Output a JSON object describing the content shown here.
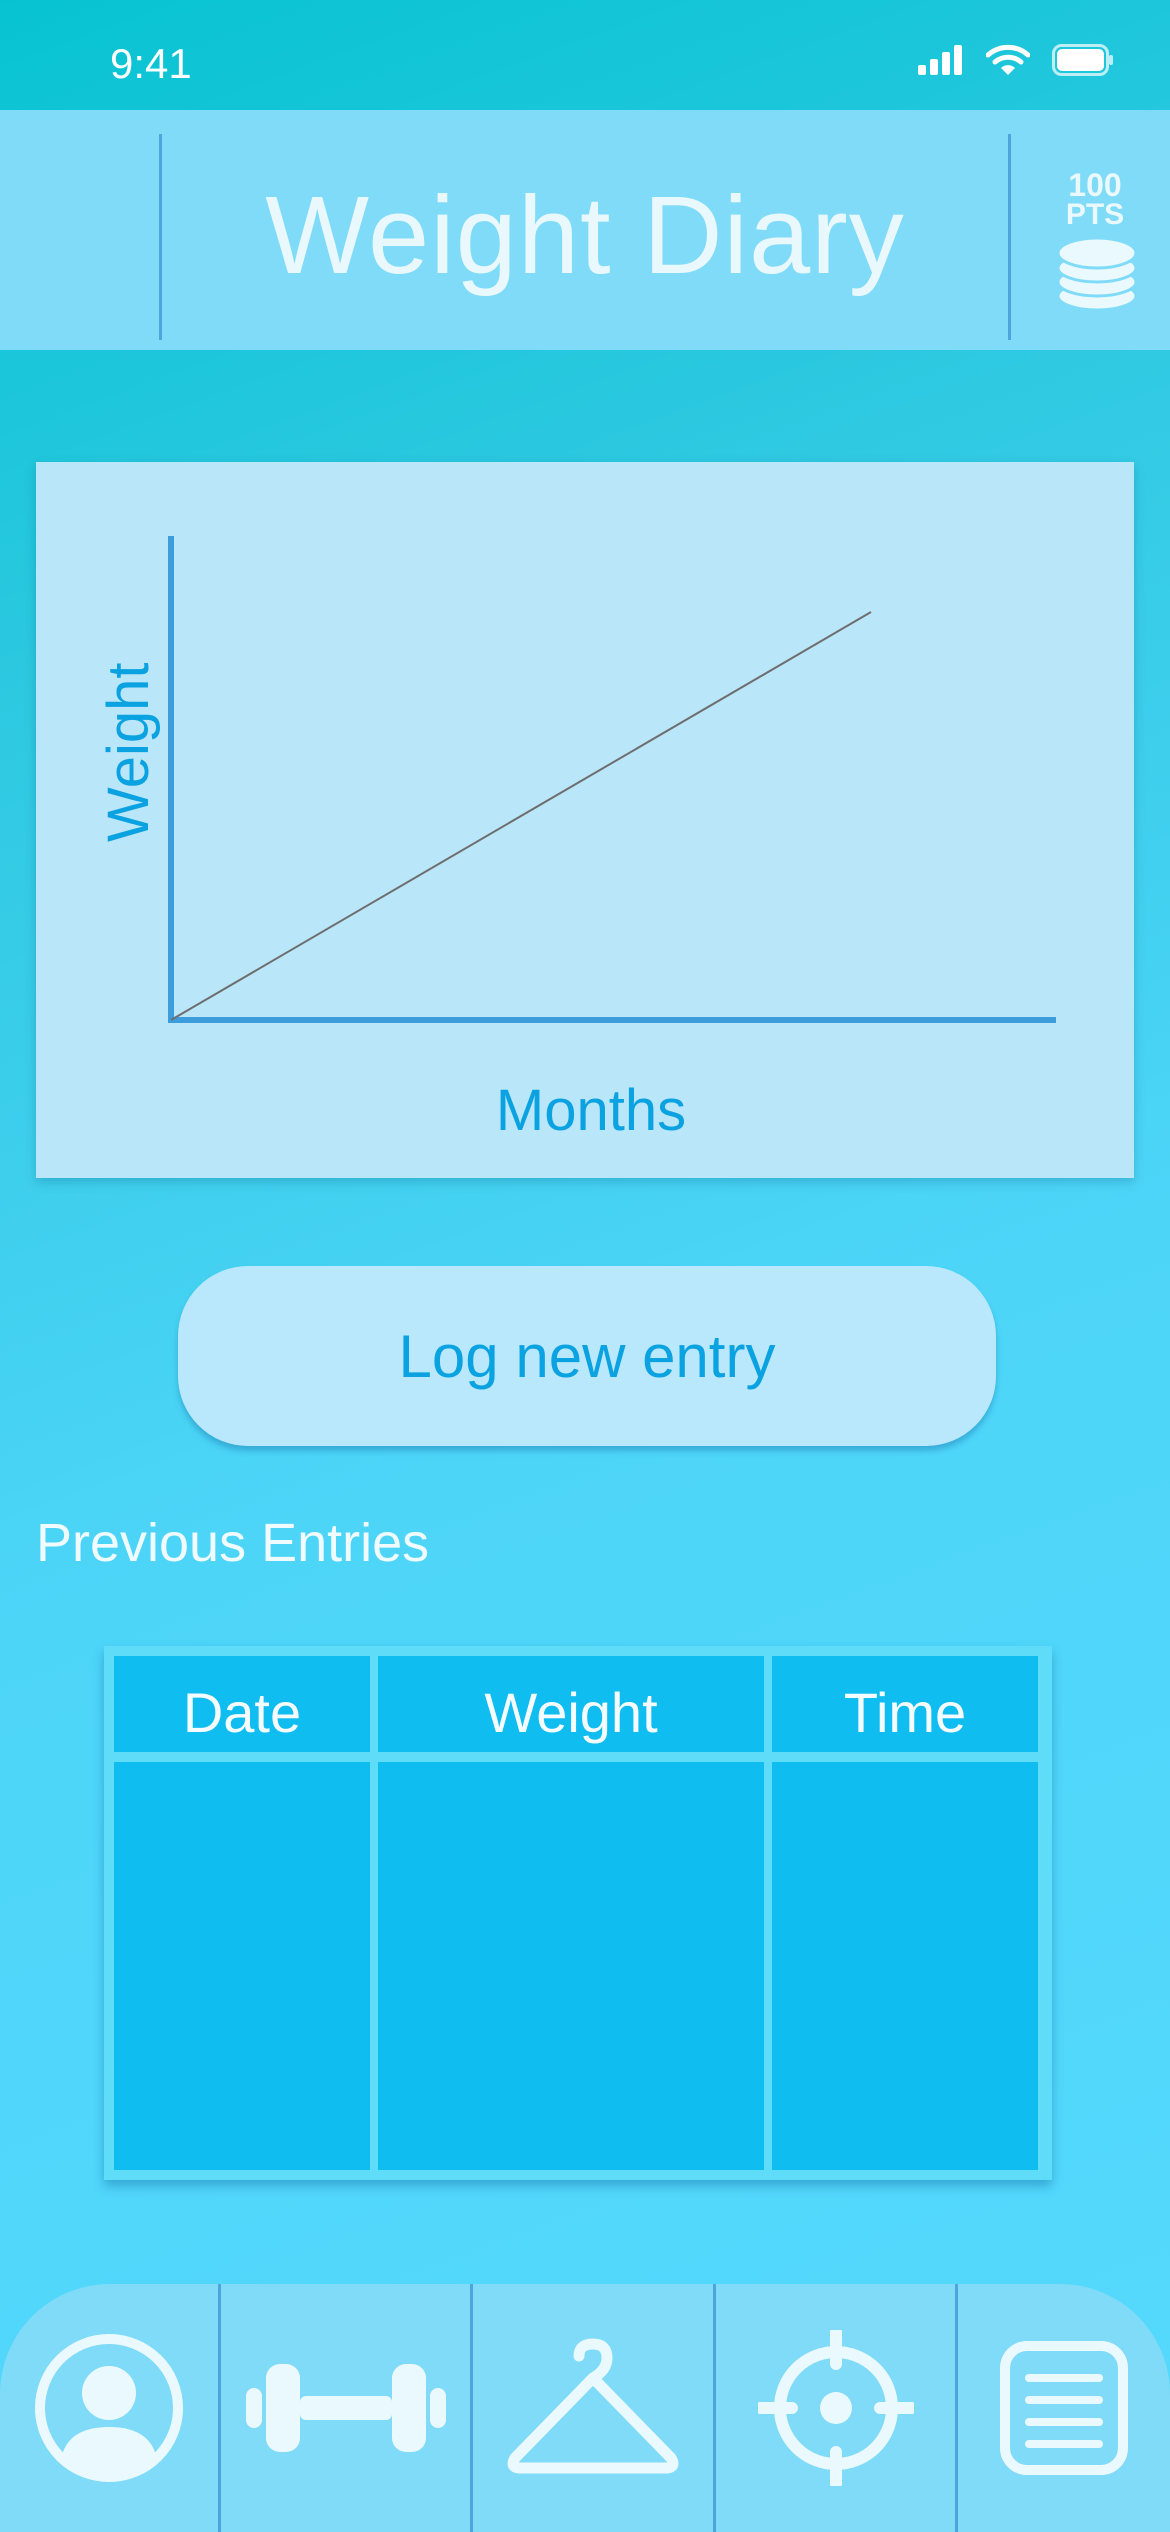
{
  "status_bar": {
    "time": "9:41"
  },
  "header": {
    "title": "Weight Diary",
    "points": {
      "value": "100",
      "unit": "PTS",
      "icon": "coin-stack-icon"
    }
  },
  "chart_data": {
    "type": "line",
    "xlabel": "Months",
    "ylabel": "Weight",
    "series": [
      {
        "x": [
          0,
          1
        ],
        "y": [
          0,
          1
        ]
      }
    ]
  },
  "log_button": {
    "label": "Log new entry"
  },
  "previous_entries": {
    "title": "Previous Entries",
    "columns": [
      "Date",
      "Weight",
      "Time"
    ],
    "rows": []
  },
  "bottom_nav": {
    "items": [
      {
        "icon": "profile-icon"
      },
      {
        "icon": "dumbbell-icon"
      },
      {
        "icon": "hanger-icon"
      },
      {
        "icon": "target-icon"
      },
      {
        "icon": "list-icon"
      }
    ]
  },
  "colors": {
    "accent": "#0aa2e0",
    "header_bg": "#7fdbf7",
    "chart_bg": "#b9e6f9",
    "table_cell": "#0fbdf1",
    "axis": "#3c9ddc"
  }
}
